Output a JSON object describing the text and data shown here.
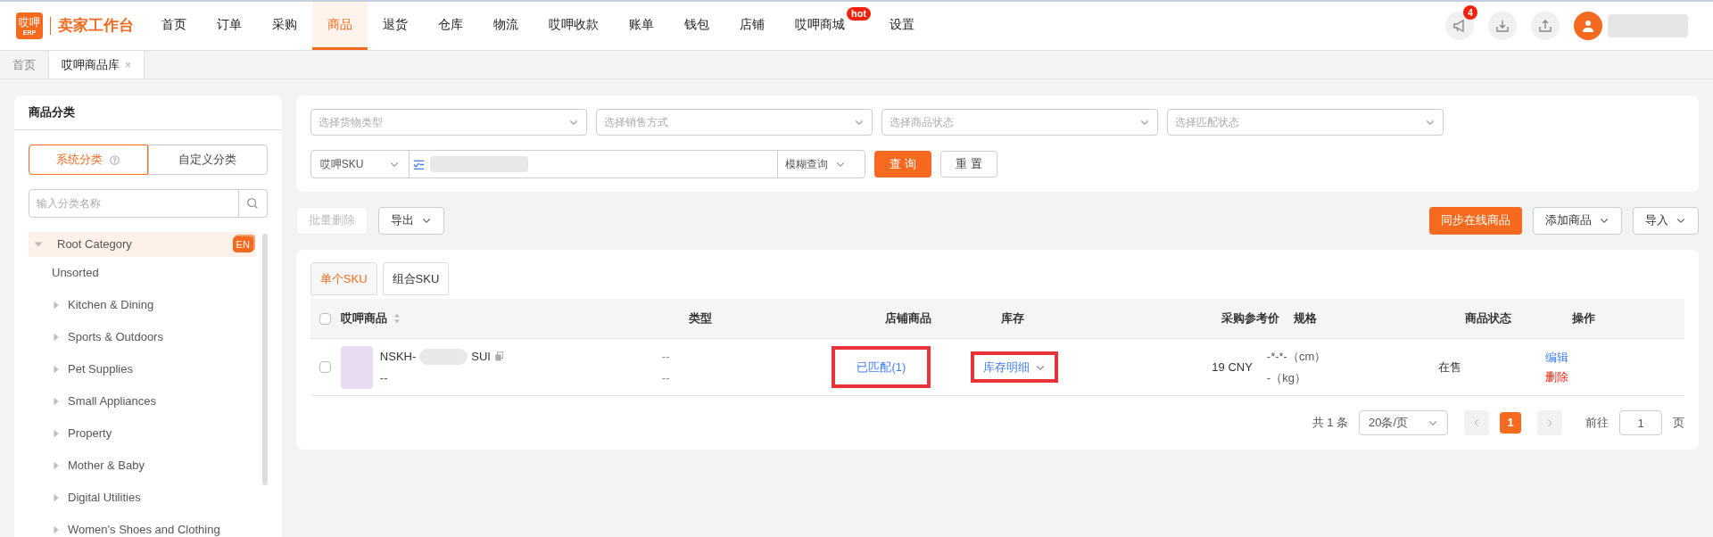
{
  "logo": {
    "mark": "哎呷",
    "sub": "ERP",
    "title": "卖家工作台"
  },
  "nav": [
    {
      "label": "首页",
      "selected": false
    },
    {
      "label": "订单",
      "selected": false
    },
    {
      "label": "采购",
      "selected": false
    },
    {
      "label": "商品",
      "selected": true
    },
    {
      "label": "退货",
      "selected": false
    },
    {
      "label": "仓库",
      "selected": false
    },
    {
      "label": "物流",
      "selected": false
    },
    {
      "label": "哎呷收款",
      "selected": false
    },
    {
      "label": "账单",
      "selected": false
    },
    {
      "label": "钱包",
      "selected": false
    },
    {
      "label": "店铺",
      "selected": false
    },
    {
      "label": "哎呷商城",
      "selected": false,
      "badge": "hot"
    },
    {
      "label": "设置",
      "selected": false
    }
  ],
  "header_actions": {
    "notification_count": "4"
  },
  "page_tabs": [
    {
      "label": "首页",
      "selected": false,
      "closable": false
    },
    {
      "label": "哎呷商品库",
      "selected": true,
      "closable": true,
      "close": "×"
    }
  ],
  "category_panel": {
    "title": "商品分类",
    "modes": [
      {
        "label": "系统分类",
        "selected": true,
        "help": true
      },
      {
        "label": "自定义分类",
        "selected": false,
        "help": false
      }
    ],
    "search_placeholder": "输入分类名称",
    "tree": [
      {
        "label": "Root Category",
        "expanded": true,
        "selected": true,
        "badge": "EN",
        "children": [
          {
            "label": "Unsorted",
            "kind": "leaf"
          },
          {
            "label": "Kitchen & Dining",
            "kind": "branch"
          },
          {
            "label": "Sports & Outdoors",
            "kind": "branch"
          },
          {
            "label": "Pet Supplies",
            "kind": "branch"
          },
          {
            "label": "Small Appliances",
            "kind": "branch"
          },
          {
            "label": "Property",
            "kind": "branch"
          },
          {
            "label": "Mother & Baby",
            "kind": "branch"
          },
          {
            "label": "Digital Utilities",
            "kind": "branch"
          },
          {
            "label": "Women's Shoes and Clothing",
            "kind": "branch"
          }
        ]
      }
    ]
  },
  "filters": {
    "selects": [
      {
        "placeholder": "选择货物类型"
      },
      {
        "placeholder": "选择销售方式"
      },
      {
        "placeholder": "选择商品状态"
      },
      {
        "placeholder": "选择匹配状态"
      }
    ],
    "sku_field": "哎呷SKU",
    "match_mode": "模糊查询",
    "query_button": "查 询",
    "reset_button": "重 置"
  },
  "toolbar": {
    "left": [
      {
        "label": "批量删除",
        "disabled": true,
        "dropdown": false
      },
      {
        "label": "导出",
        "disabled": false,
        "dropdown": true
      }
    ],
    "right": [
      {
        "label": "同步在线商品",
        "primary": true,
        "dropdown": false
      },
      {
        "label": "添加商品",
        "primary": false,
        "dropdown": true
      },
      {
        "label": "导入",
        "primary": false,
        "dropdown": true
      }
    ]
  },
  "sku_tabs": [
    {
      "label": "单个SKU",
      "selected": true
    },
    {
      "label": "组合SKU",
      "selected": false
    }
  ],
  "table": {
    "select_all_checked": false,
    "columns": [
      {
        "label": "哎呷商品",
        "sortable": true
      },
      {
        "label": "类型",
        "sortable": false
      },
      {
        "label": "店铺商品",
        "sortable": false
      },
      {
        "label": "库存",
        "sortable": false
      },
      {
        "label": "采购参考价",
        "sortable": false
      },
      {
        "label": "规格",
        "sortable": false
      },
      {
        "label": "商品状态",
        "sortable": false
      },
      {
        "label": "操作",
        "sortable": false
      }
    ],
    "rows": [
      {
        "checked": false,
        "sku_start": "NSKH-",
        "sku_end": "SUI",
        "sub": "--",
        "type": [
          "--",
          "--"
        ],
        "store_link": "已匹配(1)",
        "stock_link": "库存明细",
        "price": "19 CNY",
        "spec": [
          "-*-*-（cm）",
          "-（kg）"
        ],
        "status": "在售",
        "actions": [
          {
            "label": "编辑",
            "kind": "edit"
          },
          {
            "label": "删除",
            "kind": "delete"
          }
        ]
      }
    ]
  },
  "pagination": {
    "total": "共 1 条",
    "page_size": "20条/页",
    "pages": [
      {
        "label": "1",
        "selected": true
      }
    ],
    "goto_label": "前往",
    "goto_value": "1",
    "goto_unit": "页"
  }
}
